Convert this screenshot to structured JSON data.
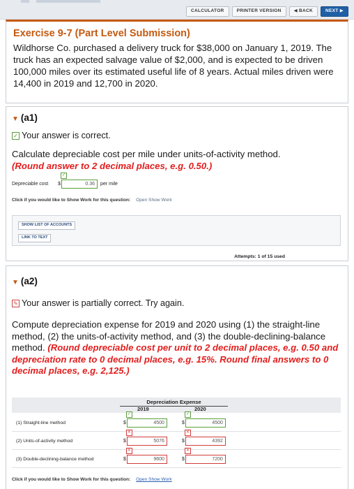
{
  "toolbar": {
    "calculator": "CALCULATOR",
    "printer_version": "PRINTER VERSION",
    "back": "◀ BACK",
    "next": "NEXT ▶"
  },
  "exercise": {
    "title": "Exercise 9-7 (Part Level Submission)",
    "body": "Wildhorse Co. purchased a delivery truck for $38,000 on January 1, 2019. The truck has an expected salvage value of $2,000, and is expected to be driven 100,000 miles over its estimated useful life of 8 years. Actual miles driven were 14,400 in 2019 and 12,700 in 2020."
  },
  "a1": {
    "heading": "(a1)",
    "status": "Your answer is correct.",
    "question": "Calculate depreciable cost per mile under units-of-activity method.",
    "instruction": "(Round answer to 2 decimal places, e.g. 0.50.)",
    "label": "Depreciable cost",
    "currency": "$",
    "value": "0.36",
    "unit": "per mile",
    "show_work_prompt": "Click if you would like to Show Work for this question:",
    "show_work_link": "Open Show Work",
    "show_accounts_btn": "SHOW LIST OF ACCOUNTS",
    "link_to_text_btn": "LINK TO TEXT",
    "attempts": "Attempts: 1 of 15 used"
  },
  "a2": {
    "heading": "(a2)",
    "status": "Your answer is partially correct.  Try again.",
    "question": "Compute depreciation expense for 2019 and 2020 using (1) the straight-line method, (2) the units-of-activity method, and (3) the double-declining-balance method.",
    "instruction": "(Round depreciable cost per unit to 2 decimal places, e.g. 0.50 and depreciation rate to 0 decimal places, e.g. 15%. Round final answers to 0 decimal places, e.g. 2,125.)",
    "table": {
      "header": "Depreciation Expense",
      "year1": "2019",
      "year2": "2020",
      "rows": [
        {
          "label": "(1) Straight-line method",
          "v2019": "4500",
          "v2020": "4500",
          "ok2019": true,
          "ok2020": true
        },
        {
          "label": "(2) Units-of-activity method",
          "v2019": "5076",
          "v2020": "4392",
          "ok2019": false,
          "ok2020": false
        },
        {
          "label": "(3) Double-declining-balance method",
          "v2019": "9600",
          "v2020": "7200",
          "ok2019": false,
          "ok2020": false
        }
      ]
    },
    "show_work_prompt": "Click if you would like to Show Work for this question:",
    "show_work_link": "Open Show Work"
  },
  "colors": {
    "accent": "#c45a12",
    "instruction_red": "#e21d1d",
    "correct_green": "#58a03a",
    "wrong_red": "#d23c3c"
  }
}
